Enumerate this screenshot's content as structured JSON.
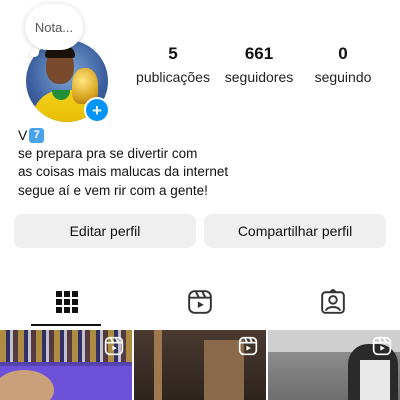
{
  "note": {
    "text": "Nota..."
  },
  "profile": {
    "add_story_symbol": "+",
    "stats": [
      {
        "value": "5",
        "label": "publicações"
      },
      {
        "value": "661",
        "label": "seguidores"
      },
      {
        "value": "0",
        "label": "seguindo"
      }
    ],
    "name": "V",
    "name_badge": "7",
    "bio_lines": [
      "se prepara pra se divertir com",
      "as coisas mais malucas da internet",
      "segue aí e vem rir com a gente!"
    ]
  },
  "buttons": {
    "edit": "Editar perfil",
    "share": "Compartilhar perfil"
  },
  "tabs": [
    {
      "icon": "grid-icon",
      "active": true
    },
    {
      "icon": "reels-icon",
      "active": false
    },
    {
      "icon": "tagged-icon",
      "active": false
    }
  ],
  "grid_items": [
    {
      "type": "reel",
      "icon": "reels-icon"
    },
    {
      "type": "reel",
      "icon": "reels-icon"
    },
    {
      "type": "reel",
      "icon": "reels-icon"
    }
  ],
  "colors": {
    "accent": "#0095f6",
    "button_bg": "#efefef",
    "badge_bg": "#4aa3e8"
  }
}
